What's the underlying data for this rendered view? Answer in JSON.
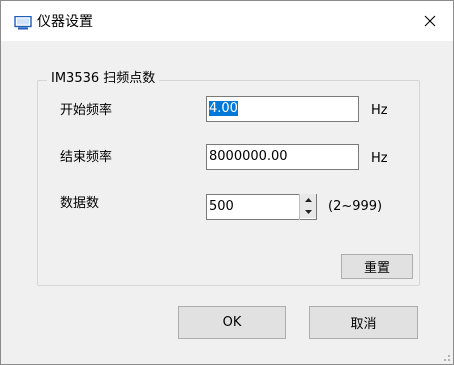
{
  "window": {
    "title": "仪器设置",
    "icons": {
      "app": "monitor-icon",
      "close": "close-icon"
    }
  },
  "group": {
    "legend": "IM3536 扫频点数",
    "start_freq": {
      "label": "开始频率",
      "value": "4.00",
      "unit": "Hz"
    },
    "end_freq": {
      "label": "结束频率",
      "value": "8000000.00",
      "unit": "Hz"
    },
    "count": {
      "label": "数据数",
      "value": "500",
      "range": "(2~999)"
    },
    "reset_label": "重置"
  },
  "buttons": {
    "ok_label": "OK",
    "cancel_label": "取消"
  },
  "colors": {
    "selection": "#0078d7",
    "dialog_bg": "#f0f0f0",
    "title_bg": "#ffffff"
  }
}
